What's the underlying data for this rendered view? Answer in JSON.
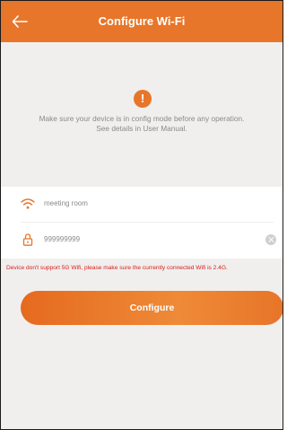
{
  "header": {
    "title": "Configure Wi-Fi",
    "back_icon": "arrow-left-icon"
  },
  "notice": {
    "icon_text": "!",
    "line1": "Make sure your device is in config mode before any operation.",
    "line2": "See details in User Manual."
  },
  "form": {
    "ssid": {
      "icon": "wifi-icon",
      "value": "meeting room"
    },
    "password": {
      "icon": "lock-icon",
      "value": "999999999",
      "clear_icon": "clear-icon"
    }
  },
  "warning": "Device don't support 5G Wifi, please make sure the currently connected Wifi is 2.4G.",
  "configure_button": "Configure",
  "colors": {
    "accent": "#e7762a",
    "warning": "#d6201f",
    "background": "#f0efed"
  }
}
